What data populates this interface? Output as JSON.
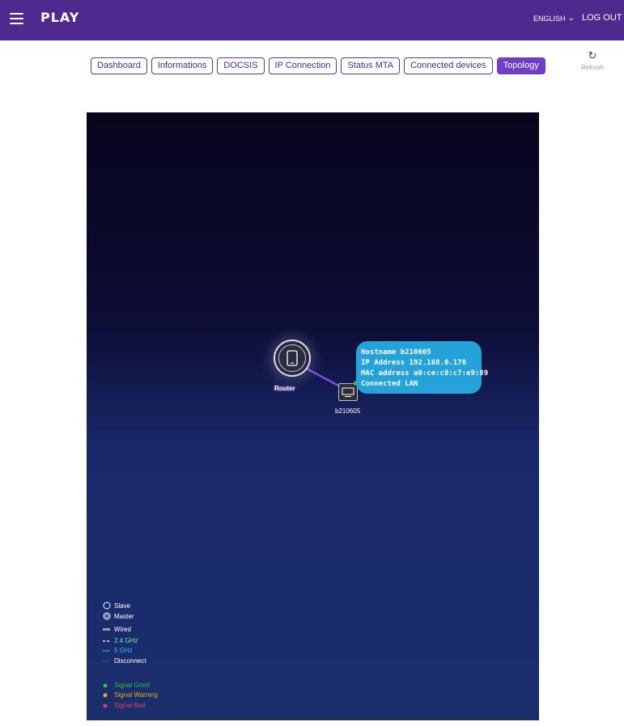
{
  "header": {
    "logo": "PLAY",
    "language": "ENGLISH",
    "logout": "LOG OUT"
  },
  "tabs": [
    {
      "label": "Dashboard",
      "active": false
    },
    {
      "label": "Informations",
      "active": false
    },
    {
      "label": "DOCSIS",
      "active": false
    },
    {
      "label": "IP Connection",
      "active": false
    },
    {
      "label": "Status MTA",
      "active": false
    },
    {
      "label": "Connected devices",
      "active": false
    },
    {
      "label": "Topology",
      "active": true
    }
  ],
  "refresh": {
    "label": "Refresh",
    "icon": "refresh-icon"
  },
  "topology": {
    "router_label": "Router",
    "device_label": "b210605",
    "link_color": "#7b4fd6",
    "tooltip": {
      "hostname": "Hostname b210605",
      "ip": "IP Address 192.168.0.178",
      "mac": "MAC address a0:ce:c8:c7:e9:89",
      "connected": "Connected LAN"
    }
  },
  "legend": {
    "slave": "Slave",
    "master": "Master",
    "wired": "Wired",
    "ghz24": "2.4 GHz",
    "ghz5": "5 GHz",
    "disconnect": "Disconnect",
    "signal_good": "Signal Good",
    "signal_warning": "Signal Warning",
    "signal_bad": "Signal Bad",
    "colors": {
      "wired": "#9a9a9a",
      "ghz24": "#6cf0a0",
      "ghz5": "#2ec5ff",
      "good": "#3cb54a",
      "warning": "#e0b020",
      "bad": "#e04060"
    }
  }
}
